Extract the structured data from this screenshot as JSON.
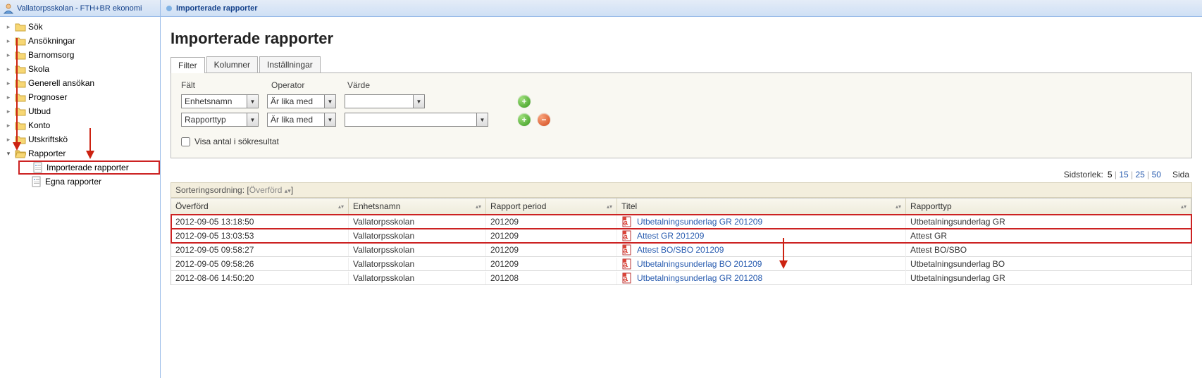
{
  "sidebar": {
    "title": "Vallatorpsskolan - FTH+BR ekonomi",
    "items": [
      {
        "label": "Sök",
        "expanded": false
      },
      {
        "label": "Ansökningar",
        "expanded": false
      },
      {
        "label": "Barnomsorg",
        "expanded": false
      },
      {
        "label": "Skola",
        "expanded": false
      },
      {
        "label": "Generell ansökan",
        "expanded": false
      },
      {
        "label": "Prognoser",
        "expanded": false
      },
      {
        "label": "Utbud",
        "expanded": false
      },
      {
        "label": "Konto",
        "expanded": false
      },
      {
        "label": "Utskriftskö",
        "expanded": false
      },
      {
        "label": "Rapporter",
        "expanded": true
      }
    ],
    "reports_children": [
      {
        "label": "Importerade rapporter",
        "selected": true
      },
      {
        "label": "Egna rapporter",
        "selected": false
      }
    ]
  },
  "breadcrumb": "Importerade rapporter",
  "page_title": "Importerade rapporter",
  "tabs": [
    {
      "label": "Filter",
      "active": true
    },
    {
      "label": "Kolumner",
      "active": false
    },
    {
      "label": "Inställningar",
      "active": false
    }
  ],
  "filter": {
    "head": {
      "field": "Fält",
      "operator": "Operator",
      "value": "Värde"
    },
    "rows": [
      {
        "field": "Enhetsnamn",
        "operator": "Är lika med",
        "value": "",
        "value_width": 96,
        "show_remove": false
      },
      {
        "field": "Rapporttyp",
        "operator": "Är lika med",
        "value": "",
        "value_width": 186,
        "show_remove": true
      }
    ],
    "checkbox_label": "Visa antal i sökresultat"
  },
  "paging": {
    "label": "Sidstorlek:",
    "options": [
      "5",
      "15",
      "25",
      "50"
    ],
    "current": "5",
    "sida_label": "Sida"
  },
  "sort": {
    "label": "Sorteringsordning:",
    "chip": "Överförd"
  },
  "grid": {
    "columns": [
      {
        "key": "date",
        "label": "Överförd"
      },
      {
        "key": "unit",
        "label": "Enhetsnamn"
      },
      {
        "key": "period",
        "label": "Rapport period"
      },
      {
        "key": "title",
        "label": "Titel"
      },
      {
        "key": "type",
        "label": "Rapporttyp"
      }
    ],
    "rows": [
      {
        "date": "2012-09-05 13:18:50",
        "unit": "Vallatorpsskolan",
        "period": "201209",
        "title": "Utbetalningsunderlag GR 201209",
        "type": "Utbetalningsunderlag GR",
        "hl": true
      },
      {
        "date": "2012-09-05 13:03:53",
        "unit": "Vallatorpsskolan",
        "period": "201209",
        "title": "Attest GR 201209",
        "type": "Attest GR",
        "hl": true
      },
      {
        "date": "2012-09-05 09:58:27",
        "unit": "Vallatorpsskolan",
        "period": "201209",
        "title": "Attest BO/SBO 201209",
        "type": "Attest BO/SBO",
        "hl": false
      },
      {
        "date": "2012-09-05 09:58:26",
        "unit": "Vallatorpsskolan",
        "period": "201209",
        "title": "Utbetalningsunderlag BO 201209",
        "type": "Utbetalningsunderlag BO",
        "hl": false
      },
      {
        "date": "2012-08-06 14:50:20",
        "unit": "Vallatorpsskolan",
        "period": "201208",
        "title": "Utbetalningsunderlag GR 201208",
        "type": "Utbetalningsunderlag GR",
        "hl": false
      }
    ]
  }
}
